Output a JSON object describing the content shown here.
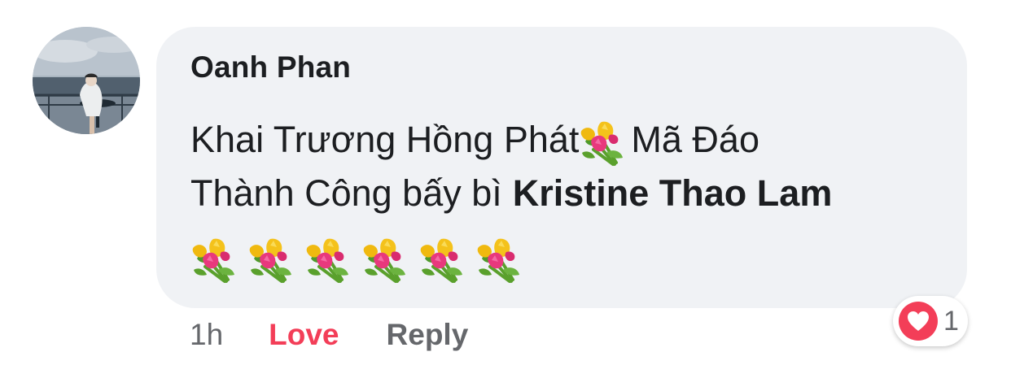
{
  "comment": {
    "author": "Oanh Phan",
    "line1_part1": "Khai Trương Hồng Phát",
    "line1_part2": "Mã Đáo",
    "line2_text": "Thành Công bấy bì",
    "mention": "Kristine Thao Lam",
    "flower_icon": "bouquet-emoji",
    "flower_row_count": 6
  },
  "actions": {
    "time": "1h",
    "love_label": "Love",
    "reply_label": "Reply"
  },
  "reaction": {
    "icon": "heart-icon",
    "count": "1"
  },
  "colors": {
    "bubble": "#f0f2f5",
    "love": "#f33e58",
    "muted": "#65676b",
    "text": "#1c1e21"
  }
}
